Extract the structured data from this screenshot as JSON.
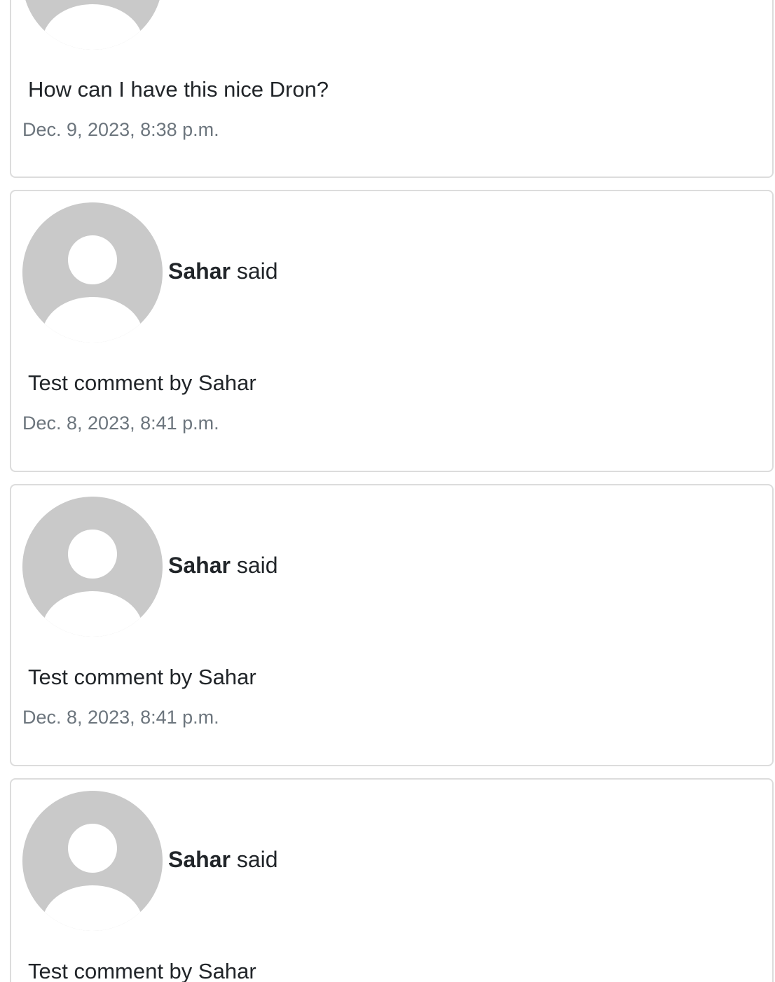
{
  "comments": [
    {
      "author": "",
      "said": "",
      "body": "How can I have this nice Dron?",
      "date": "Dec. 9, 2023, 8:38 p.m."
    },
    {
      "author": "Sahar",
      "said": "said",
      "body": "Test comment by Sahar",
      "date": "Dec. 8, 2023, 8:41 p.m."
    },
    {
      "author": "Sahar",
      "said": "said",
      "body": "Test comment by Sahar",
      "date": "Dec. 8, 2023, 8:41 p.m."
    },
    {
      "author": "Sahar",
      "said": "said",
      "body": "Test comment by Sahar",
      "date": ""
    }
  ],
  "colors": {
    "border": "#dcdcdc",
    "avatar_bg": "#c9c9c9",
    "muted_text": "#6c757d",
    "text": "#212529"
  }
}
